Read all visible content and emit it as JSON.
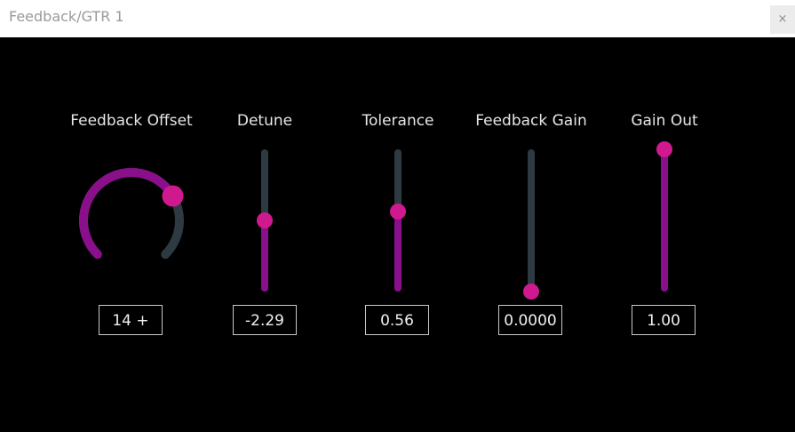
{
  "window": {
    "title": "Feedback/GTR 1",
    "close_glyph": "×"
  },
  "colors": {
    "accent": "#d1198f",
    "fill": "#8a0f8a",
    "track": "#2e3a42",
    "background": "#000000"
  },
  "controls": {
    "feedback_offset": {
      "label": "Feedback Offset",
      "value": "14 +",
      "level": 0.72
    },
    "detune": {
      "label": "Detune",
      "value": "-2.29",
      "level": 0.5
    },
    "tolerance": {
      "label": "Tolerance",
      "value": "0.56",
      "level": 0.56
    },
    "feedback_gain": {
      "label": "Feedback Gain",
      "value": "0.0000",
      "level": 0.0
    },
    "gain_out": {
      "label": "Gain Out",
      "value": "1.00",
      "level": 1.0
    }
  }
}
